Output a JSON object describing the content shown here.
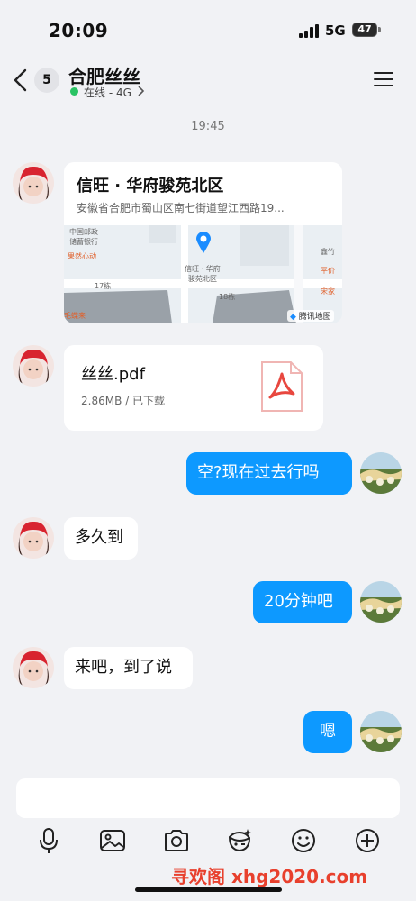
{
  "status_bar": {
    "time": "20:09",
    "network": "5G",
    "battery": "47"
  },
  "header": {
    "unread_count": "5",
    "title": "合肥丝丝",
    "presence": "在线 - 4G"
  },
  "time_divider": "19:45",
  "location_card": {
    "title": "信旺 · 华府骏苑北区",
    "address": "安徽省合肥市蜀山区南七街道望江西路19...",
    "map": {
      "pin_label_line1": "信旺 · 华府",
      "pin_label_line2": "骏苑北区",
      "bank_line1": "中国邮政",
      "bank_line2": "储蓄银行",
      "poi_left": "果然心动",
      "building_17": "17栋",
      "building_18": "18栋",
      "poi_bottom_left": "毛蝶来",
      "poi_right_1": "鑫竹",
      "poi_right_2": "平价",
      "poi_right_3": "宋家",
      "map_brand": "腾讯地图"
    }
  },
  "file_card": {
    "name": "丝丝.pdf",
    "meta": "2.86MB / 已下载"
  },
  "messages": [
    {
      "direction": "out",
      "text": "空?现在过去行吗"
    },
    {
      "direction": "in",
      "text": "多久到"
    },
    {
      "direction": "out",
      "text": "20分钟吧"
    },
    {
      "direction": "in",
      "text": "来吧，到了说"
    },
    {
      "direction": "out",
      "text": "嗯"
    }
  ],
  "input": {
    "placeholder": ""
  },
  "toolbar": {
    "icons": [
      "microphone-icon",
      "image-icon",
      "camera-icon",
      "sticker-icon",
      "emoji-icon",
      "plus-icon"
    ]
  },
  "watermark": "寻欢阁 xhg2020.com",
  "colors": {
    "accent": "#0d99ff",
    "online": "#29c363",
    "background": "#f1f2f5"
  }
}
